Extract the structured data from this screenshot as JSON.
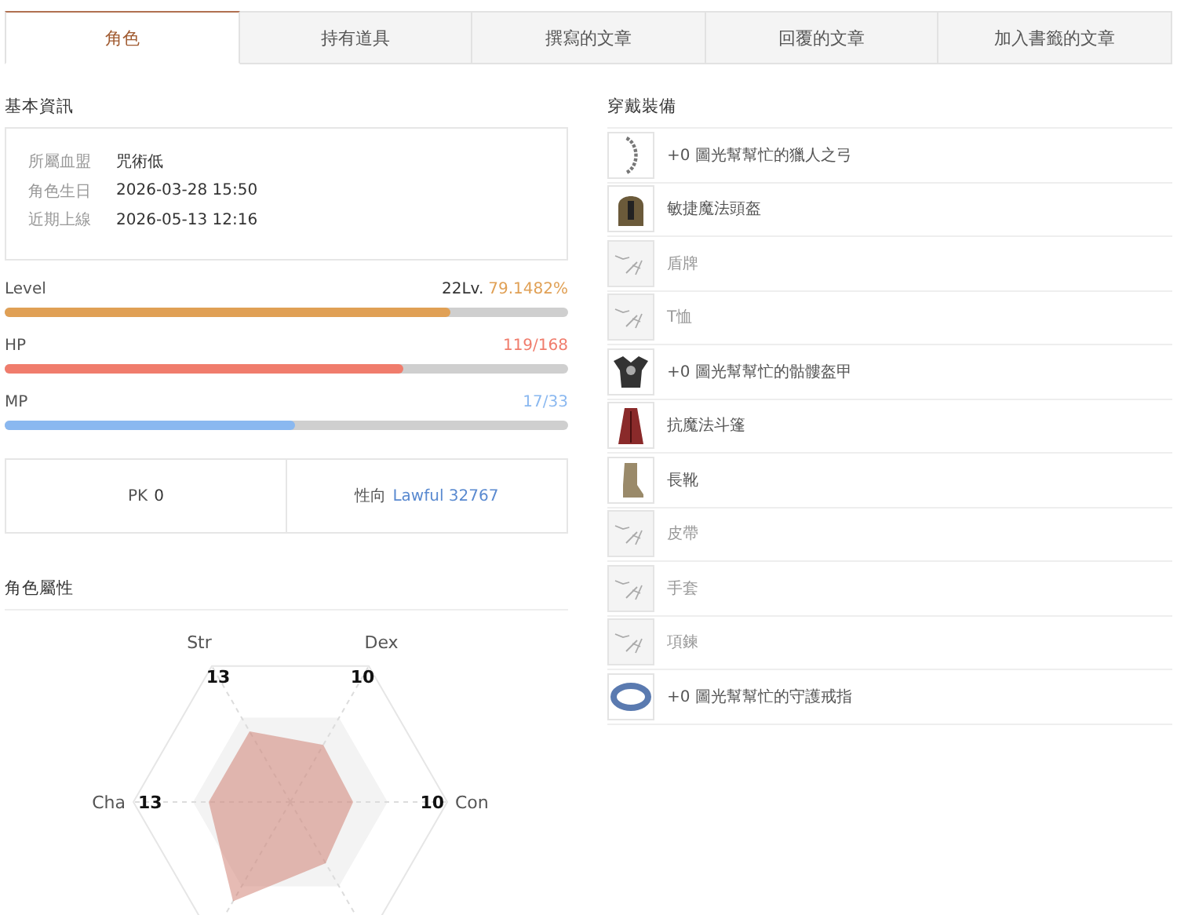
{
  "tabs": [
    {
      "label": "角色",
      "selected": true
    },
    {
      "label": "持有道具",
      "selected": false
    },
    {
      "label": "撰寫的文章",
      "selected": false
    },
    {
      "label": "回覆的文章",
      "selected": false
    },
    {
      "label": "加入書籤的文章",
      "selected": false
    }
  ],
  "basic_info": {
    "title": "基本資訊",
    "fields": [
      {
        "label": "所屬血盟",
        "value": "咒術低"
      },
      {
        "label": "角色生日",
        "value": "2026-03-28 15:50"
      },
      {
        "label": "近期上線",
        "value": "2026-05-13 12:16"
      }
    ]
  },
  "bars": [
    {
      "label": "Level",
      "prefix": "22Lv.",
      "reading": "79.1482%",
      "level": 0.79,
      "color": "#e0a055"
    },
    {
      "label": "HP",
      "reading": "119/168",
      "level": 0.708,
      "color": "#f07c6c"
    },
    {
      "label": "MP",
      "reading": "17/33",
      "level": 0.515,
      "color": "#8ab8f0"
    }
  ],
  "pk": {
    "label": "PK",
    "value": "0"
  },
  "alignment": {
    "label": "性向",
    "value": "Lawful 32767"
  },
  "attributes": {
    "title": "角色屬性",
    "stats": [
      {
        "name": "Str",
        "value": "13"
      },
      {
        "name": "Dex",
        "value": "10"
      },
      {
        "name": "Con",
        "value": "10"
      },
      {
        "name": "Cha",
        "value": "13"
      }
    ]
  },
  "equipment": {
    "title": "穿戴裝備",
    "items": [
      {
        "kind": "bow",
        "name": "+0 圖光幫幫忙的獵人之弓"
      },
      {
        "kind": "helmet",
        "name": "敏捷魔法頭盔"
      },
      {
        "kind": "empty",
        "name": "盾牌"
      },
      {
        "kind": "empty",
        "name": "T恤"
      },
      {
        "kind": "armor",
        "name": "+0 圖光幫幫忙的骷髏盔甲"
      },
      {
        "kind": "cloak",
        "name": "抗魔法斗篷"
      },
      {
        "kind": "boots",
        "name": "長靴"
      },
      {
        "kind": "empty",
        "name": "皮帶"
      },
      {
        "kind": "empty",
        "name": "手套"
      },
      {
        "kind": "empty",
        "name": "項鍊"
      },
      {
        "kind": "ring",
        "name": "+0 圖光幫幫忙的守護戒指"
      }
    ]
  }
}
